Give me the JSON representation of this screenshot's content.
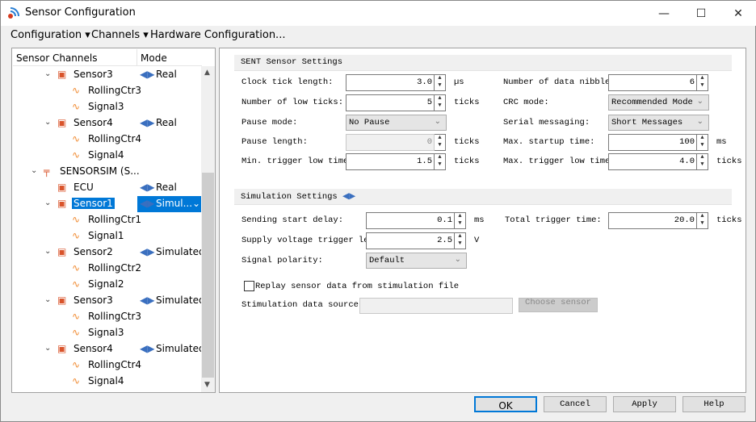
{
  "window": {
    "title": "Sensor Configuration",
    "minimize": "—",
    "maximize": "☐",
    "close": "✕"
  },
  "menu": [
    "Configuration ▾",
    "Channels ▾",
    "Hardware Configuration..."
  ],
  "tree": {
    "col_channels": "Sensor Channels",
    "col_mode": "Mode",
    "rows": [
      {
        "name": "Sensor3",
        "type": "sensor",
        "level": 2,
        "expanded": true,
        "mode": "Real"
      },
      {
        "name": "RollingCtr3",
        "type": "signal",
        "level": 3
      },
      {
        "name": "Signal3",
        "type": "signal",
        "level": 3
      },
      {
        "name": "Sensor4",
        "type": "sensor",
        "level": 2,
        "expanded": true,
        "mode": "Real"
      },
      {
        "name": "RollingCtr4",
        "type": "signal",
        "level": 3
      },
      {
        "name": "Signal4",
        "type": "signal",
        "level": 3
      },
      {
        "name": "SENSORSIM (S...",
        "type": "device",
        "level": 1,
        "expanded": true
      },
      {
        "name": "ECU",
        "type": "sensor",
        "level": 2,
        "mode": "Real"
      },
      {
        "name": "Sensor1",
        "type": "sensor",
        "level": 2,
        "expanded": true,
        "mode": "Simul...",
        "selected": true
      },
      {
        "name": "RollingCtr1",
        "type": "signal",
        "level": 3
      },
      {
        "name": "Signal1",
        "type": "signal",
        "level": 3
      },
      {
        "name": "Sensor2",
        "type": "sensor",
        "level": 2,
        "expanded": true,
        "mode": "Simulated"
      },
      {
        "name": "RollingCtr2",
        "type": "signal",
        "level": 3
      },
      {
        "name": "Signal2",
        "type": "signal",
        "level": 3
      },
      {
        "name": "Sensor3",
        "type": "sensor",
        "level": 2,
        "expanded": true,
        "mode": "Simulated"
      },
      {
        "name": "RollingCtr3",
        "type": "signal",
        "level": 3
      },
      {
        "name": "Signal3",
        "type": "signal",
        "level": 3
      },
      {
        "name": "Sensor4",
        "type": "sensor",
        "level": 2,
        "expanded": true,
        "mode": "Simulated"
      },
      {
        "name": "RollingCtr4",
        "type": "signal",
        "level": 3
      },
      {
        "name": "Signal4",
        "type": "signal",
        "level": 3
      }
    ]
  },
  "sent": {
    "title": "SENT Sensor Settings",
    "clock_tick": {
      "label": "Clock tick length:",
      "value": "3.0",
      "unit": "µs"
    },
    "low_ticks": {
      "label": "Number of low ticks:",
      "value": "5",
      "unit": "ticks"
    },
    "pause_mode": {
      "label": "Pause mode:",
      "value": "No Pause"
    },
    "pause_length": {
      "label": "Pause length:",
      "value": "0",
      "unit": "ticks"
    },
    "min_trigger": {
      "label": "Min. trigger low time",
      "value": "1.5",
      "unit": "ticks"
    },
    "nibbles": {
      "label": "Number of data nibbles:",
      "value": "6"
    },
    "crc": {
      "label": "CRC mode:",
      "value": "Recommended Mode"
    },
    "serial": {
      "label": "Serial messaging:",
      "value": "Short Messages"
    },
    "startup": {
      "label": "Max. startup time:",
      "value": "100",
      "unit": "ms"
    },
    "max_trigger": {
      "label": "Max. trigger low time:",
      "value": "4.0",
      "unit": "ticks"
    }
  },
  "sim": {
    "title": "Simulation Settings",
    "start_delay": {
      "label": "Sending start delay:",
      "value": "0.1",
      "unit": "ms"
    },
    "supply": {
      "label": "Supply voltage trigger lev",
      "value": "2.5",
      "unit": "V"
    },
    "polarity": {
      "label": "Signal polarity:",
      "value": "Default"
    },
    "total_trigger": {
      "label": "Total trigger time:",
      "value": "20.0",
      "unit": "ticks"
    },
    "replay": {
      "label": "Replay sensor data from stimulation file",
      "checked": false
    },
    "source": {
      "label": "Stimulation data source:",
      "value": "",
      "button": "Choose sensor"
    }
  },
  "buttons": {
    "ok": "OK",
    "cancel": "Cancel",
    "apply": "Apply",
    "help": "Help"
  }
}
